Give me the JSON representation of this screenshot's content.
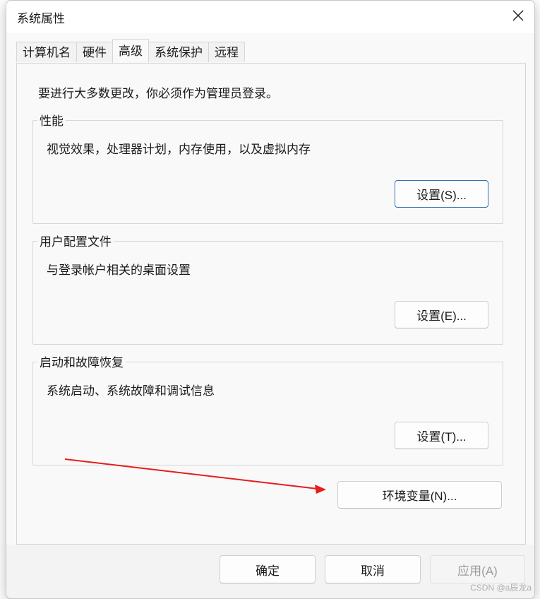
{
  "window": {
    "title": "系统属性",
    "close_icon": "close-icon"
  },
  "tabs": [
    {
      "label": "计算机名",
      "active": false
    },
    {
      "label": "硬件",
      "active": false
    },
    {
      "label": "高级",
      "active": true
    },
    {
      "label": "系统保护",
      "active": false
    },
    {
      "label": "远程",
      "active": false
    }
  ],
  "advanced": {
    "admin_note": "要进行大多数更改，你必须作为管理员登录。",
    "performance": {
      "title": "性能",
      "description": "视觉效果，处理器计划，内存使用，以及虚拟内存",
      "button_label": "设置(S)..."
    },
    "user_profiles": {
      "title": "用户配置文件",
      "description": "与登录帐户相关的桌面设置",
      "button_label": "设置(E)..."
    },
    "startup_recovery": {
      "title": "启动和故障恢复",
      "description": "系统启动、系统故障和调试信息",
      "button_label": "设置(T)..."
    },
    "env_vars_label": "环境变量(N)..."
  },
  "footer": {
    "ok_label": "确定",
    "cancel_label": "取消",
    "apply_label": "应用(A)"
  },
  "watermark": "CSDN @a辰龙a",
  "colors": {
    "annotation_arrow": "#e81c1c",
    "default_button_border": "#2f6fb5"
  }
}
